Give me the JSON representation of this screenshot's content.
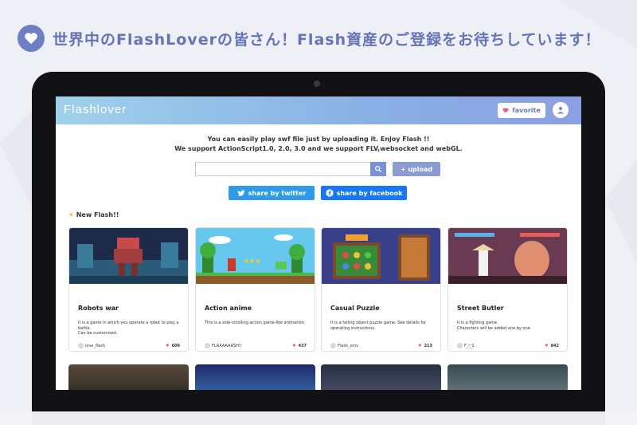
{
  "headline": "世界中のFlashLoverの皆さん！Flash資産のご登録をお待ちしています！",
  "app": {
    "logo": "Flashlover",
    "favorite_label": "favorite",
    "intro_line1": "You can easily play swf file just by uploading it. Enjoy Flash !!",
    "intro_line2": "We support ActionScript1.0, 2.0, 3.0 and we support FLV,websocket and webGL.",
    "search_placeholder": "",
    "upload_label": "+ upload",
    "share_twitter": "share by twitter",
    "share_facebook": "share by facebook",
    "section_title": "New Flash!!"
  },
  "cards": [
    {
      "title": "Robots war",
      "desc": "It is a game in which you operate a robot to play a battle.\nCan be customized.",
      "user": "love_flash",
      "likes": "609"
    },
    {
      "title": "Action anime",
      "desc": "This is a side-scrolling action game-like animation.",
      "user": "FLAAAAAASH!!",
      "likes": "437"
    },
    {
      "title": "Casual Puzzle",
      "desc": "It is a falling object puzzle game. See details for operating instructions.",
      "user": "Flash_smv",
      "likes": "213"
    },
    {
      "title": "Street Butler",
      "desc": "It is a fighting game.\nCharacters will be added one by one.",
      "user": "F_l_S",
      "likes": "842"
    }
  ],
  "colors": {
    "accent": "#6e7fc4",
    "twitter": "#2d9be9",
    "facebook": "#1877f2",
    "like": "#e85d8a"
  }
}
